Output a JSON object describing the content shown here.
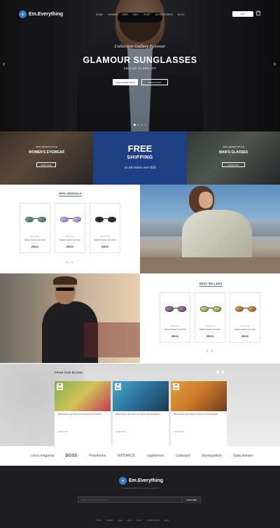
{
  "brand": {
    "name": "Em.Everything",
    "mark": "e"
  },
  "nav": [
    "HOME",
    "WOMEN",
    "MEN",
    "KIDS",
    "SHOP",
    "ACCESSORIES",
    "BLOG"
  ],
  "header": {
    "lang": "EN ▾",
    "cart": "0"
  },
  "hero": {
    "kicker": "Collection Gallery Eyewear",
    "title": "GLAMOUR SUNGLASSES",
    "subtitle": "SALE UP TO 50% OFF",
    "btn_purchase": "PURCHASE NOW",
    "btn_shop": "SHOP NOW",
    "prev": "‹",
    "next": "›"
  },
  "banners": {
    "women": {
      "kicker": "NEW SEASON STYLE",
      "title": "WOMEN'S EYEWEAR",
      "btn": "SHOP NOW"
    },
    "promo": {
      "line1": "FREE",
      "line2": "SHIPPING",
      "line3": "on all orders over $50"
    },
    "men": {
      "kicker": "NEW SEASON STYLE",
      "title": "MAN'S GLASSES",
      "btn": "SHOP NOW"
    }
  },
  "new_arrivals": {
    "title": "NEW ARRIVALS",
    "products": [
      {
        "cat": "Baby & Kids",
        "name": "Natasi Classic Cat Chair",
        "stars": "★★★★★",
        "price": "$56.00"
      },
      {
        "cat": "Baby & Kids",
        "name": "Natasi Classic Cat Chair",
        "stars": "★★★★★",
        "price": "$56.00"
      },
      {
        "cat": "Baby & Kids",
        "name": "Natasi Classic Cat Chair",
        "stars": "★★★★★",
        "price": "$56.00"
      }
    ],
    "pager": [
      "‹",
      "›"
    ]
  },
  "best_sellers": {
    "title": "BEST SELLERS",
    "products": [
      {
        "cat": "Baby & Kids",
        "name": "Natasi Classic Cat Chair",
        "stars": "★★★★★",
        "price": "$56.00"
      },
      {
        "cat": "Baby & Kids",
        "name": "Natasi Classic Cat Chair",
        "stars": "★★★★★",
        "price": "$56.00"
      },
      {
        "cat": "Baby & Kids",
        "name": "Natasi Classic Cat Chair",
        "stars": "★★★★★",
        "price": "$56.00"
      }
    ],
    "pager": [
      "‹",
      "›"
    ]
  },
  "blog": {
    "title": "FROM OUR BLOGS",
    "posts": [
      {
        "day": "28",
        "mon": "Apr",
        "title": "Pellentesque eget tellus est ultrices sed elit facilisis",
        "more": "+ Read more"
      },
      {
        "day": "28",
        "mon": "Apr",
        "title": "Pellentesque eget tellus est ultrices sed elit facilisis",
        "more": "+ Read more"
      },
      {
        "day": "28",
        "mon": "Apr",
        "title": "Pellentesque eget tellus est ultrices sed elit facilisis",
        "more": "+ Read more"
      }
    ],
    "prev": "‹",
    "next": "›"
  },
  "brands": [
    "cross magenta",
    "BOSS",
    "Prestheme",
    "WPDANCE",
    "eggthemes",
    "codespot",
    "themegallery",
    "Gala themes"
  ],
  "footer": {
    "copyright": "© 2017 EM EVERYTHING. All rights reserved.",
    "newsletter_placeholder": "Enter your email address here...",
    "subscribe": "SUBSCRIBE",
    "nav": [
      "HOME",
      "WOMEN",
      "MEN",
      "KIDS",
      "SHOP",
      "ACCESSORIES",
      "BLOG"
    ]
  },
  "colors": {
    "accent": "#3b7bd4",
    "promo": "#1f3f85",
    "footer": "#1e1e20"
  }
}
